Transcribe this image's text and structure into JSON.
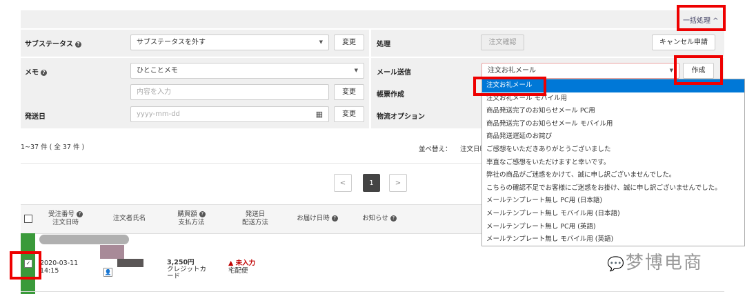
{
  "bulk": {
    "toggle_label": "一括処理 ^"
  },
  "left": {
    "substatus_label": "サブステータス",
    "substatus_value": "サブステータスを外す",
    "memo_label": "メモ",
    "memo_value": "ひとことメモ",
    "memo_placeholder": "内容を入力",
    "ship_date_label": "発送日",
    "ship_date_placeholder": "yyyy-mm-dd",
    "change_label": "変更"
  },
  "right": {
    "process_label": "処理",
    "confirm_label": "注文確認",
    "cancel_label": "キャンセル申請",
    "mail_label": "メール送信",
    "mail_value": "注文お礼メール",
    "create_label": "作成",
    "form_label": "帳票作成",
    "logistics_label": "物流オプション"
  },
  "mail_options": [
    "注文お礼メール",
    "注文お礼メール モバイル用",
    "商品発送完了のお知らせメール PC用",
    "商品発送完了のお知らせメール モバイル用",
    "商品発送遅延のお詫び",
    "ご感想をいただきありがとうございました",
    "率直なご感想をいただけますと幸いです。",
    "弊社の商品がご迷惑をかけて、誠に申し訳ございませんでした。",
    "こちらの確認不足でお客様にご迷惑をお掛け、誠に申し訳ございませんでした。",
    "メールテンプレート無し PC用 (日本語)",
    "メールテンプレート無し モバイル用 (日本語)",
    "メールテンプレート無し PC用 (英語)",
    "メールテンプレート無し モバイル用 (英語)"
  ],
  "list": {
    "count": "1~37 件 ( 全 37 件 )",
    "sort_label": "並べ替え：",
    "sort_value": "注文日時"
  },
  "pagination": {
    "prev": "<",
    "current": "1",
    "next": ">"
  },
  "table": {
    "headers": [
      [
        "受注番号",
        "注文日時"
      ],
      [
        "注文者氏名",
        ""
      ],
      [
        "購買額",
        "支払方法"
      ],
      [
        "発送日",
        "配送方法"
      ],
      [
        "お届け日時",
        ""
      ],
      [
        "お知らせ",
        ""
      ]
    ],
    "row": {
      "date": "2020-03-11",
      "time": "14:15",
      "amount": "3,250円",
      "payment": "クレジットカード",
      "ship_status": "▲ 未入力",
      "ship_method": "宅配便"
    }
  },
  "watermark": "梦博电商",
  "colors": {
    "highlight": "#0078d7",
    "annotation": "#e00000",
    "row_marker": "#3a9a3a",
    "warning": "#c00000"
  }
}
